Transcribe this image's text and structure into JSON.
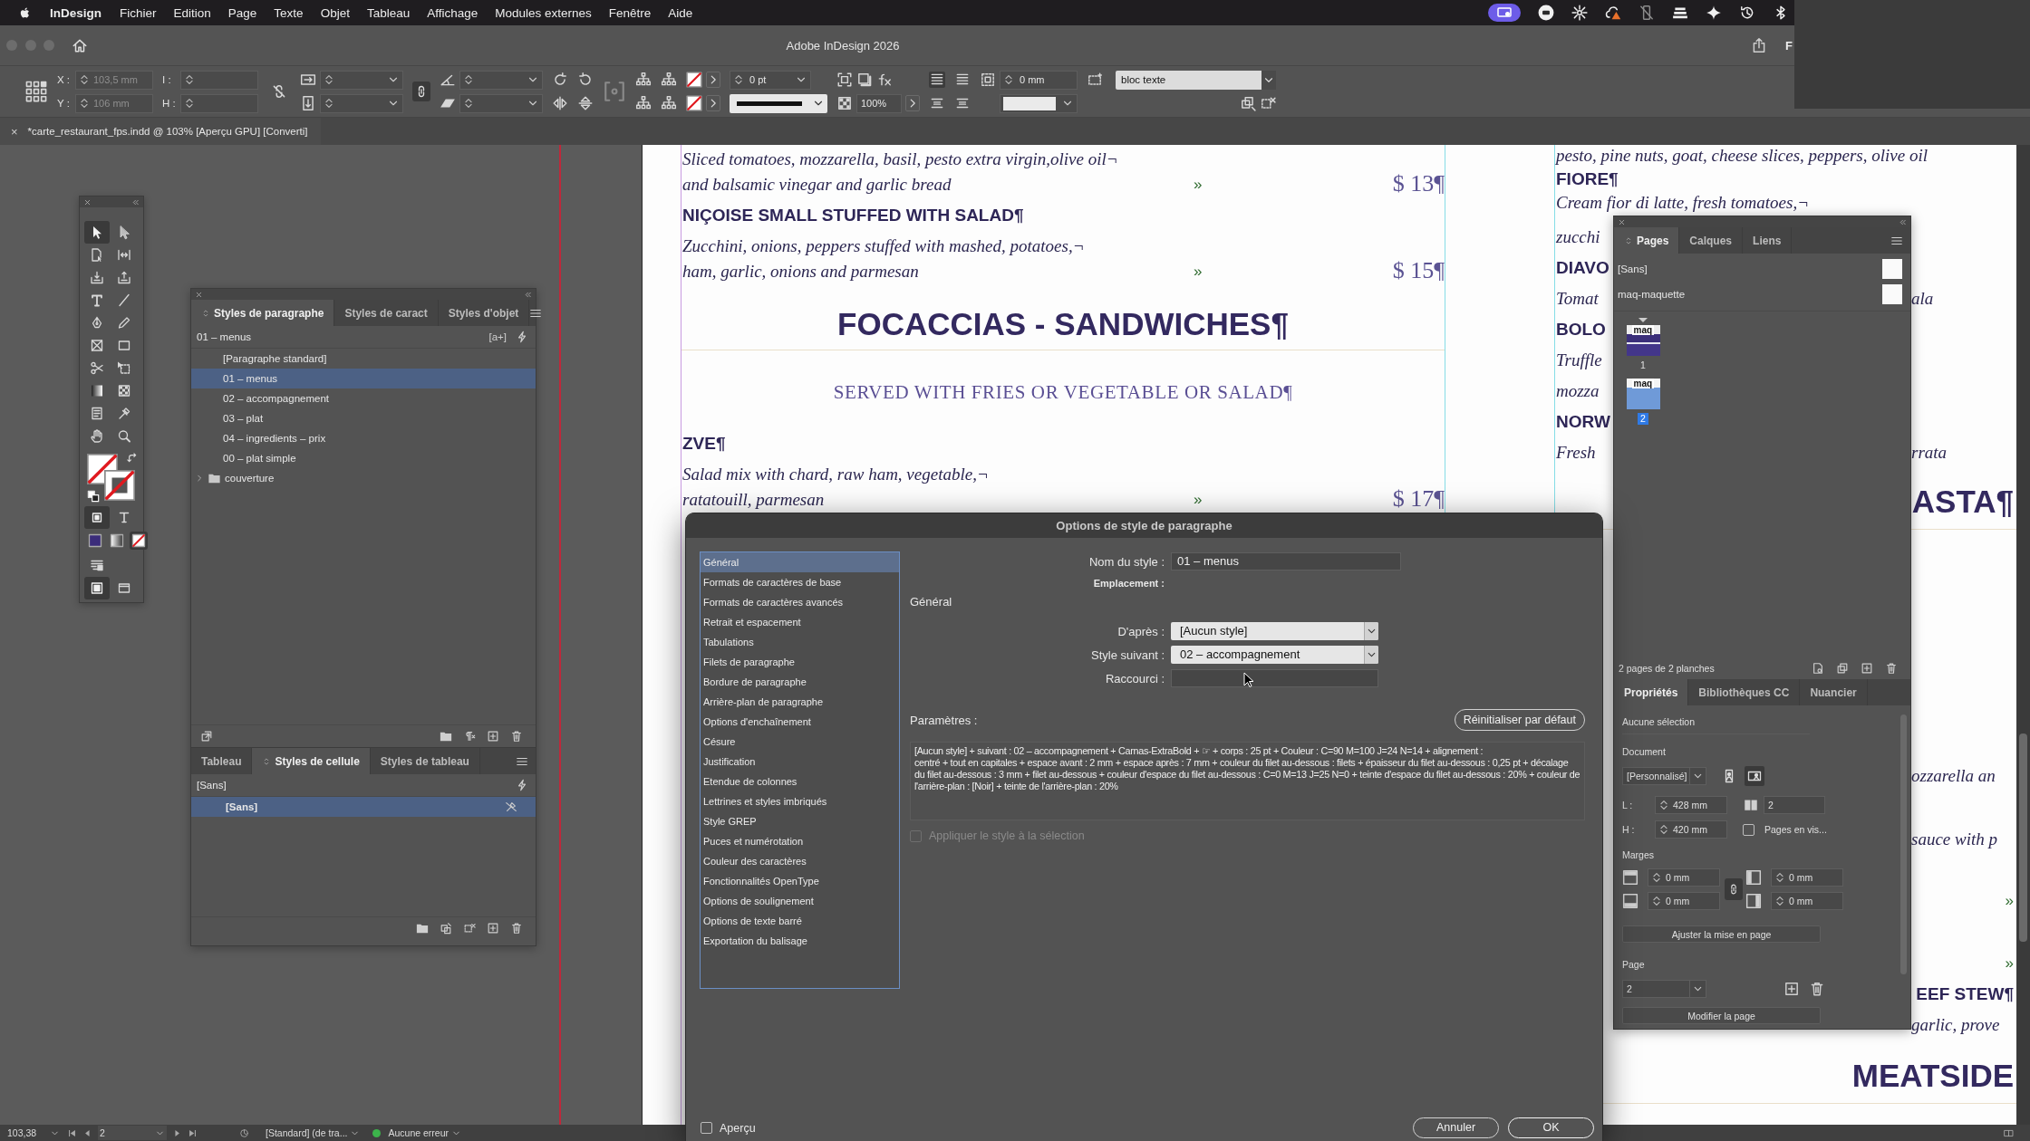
{
  "menu_bar": {
    "app": "InDesign",
    "items": [
      "Fichier",
      "Edition",
      "Page",
      "Texte",
      "Objet",
      "Tableau",
      "Affichage",
      "Modules externes",
      "Fenêtre",
      "Aide"
    ]
  },
  "title_bar": {
    "title": "Adobe InDesign 2026",
    "cut_label": "F"
  },
  "control_bar": {
    "x_label": "X :",
    "x_value": "103,5 mm",
    "y_label": "Y :",
    "y_value": "106 mm",
    "w_label": "I :",
    "h_label": "H :",
    "stroke_weight": "0 pt",
    "scale": "100%",
    "offset": "0 mm",
    "object_style": "bloc texte"
  },
  "document_tab": {
    "close": "×",
    "title": "*carte_restaurant_fps.indd @ 103% [Aperçu GPU] [Converti]"
  },
  "page": {
    "left_column": [
      {
        "kind": "dish",
        "lines": [
          "Sliced tomatoes, mozzarella, basil, pesto extra virgin,olive oil¬",
          "and balsamic vinegar and garlic bread"
        ],
        "tab": "»",
        "price": "$ 13¶"
      },
      {
        "kind": "title",
        "text": "NIÇOISE SMALL STUFFED WITH SALAD¶"
      },
      {
        "kind": "dish",
        "lines": [
          "Zucchini, onions, peppers stuffed with mashed, potatoes,¬",
          "ham, garlic, onions and parmesan"
        ],
        "tab": "»",
        "price": "$ 15¶"
      },
      {
        "kind": "section",
        "text": "FOCACCIAS - SANDWICHES¶"
      },
      {
        "kind": "subtitle",
        "text": "SERVED WITH FRIES OR VEGETABLE OR SALAD¶"
      },
      {
        "kind": "title",
        "text": "ZVE¶"
      },
      {
        "kind": "dish",
        "lines": [
          "Salad mix with chard, raw ham, vegetable,¬",
          "ratatouill, parmesan"
        ],
        "tab": "»",
        "price": "$ 17¶"
      }
    ],
    "right_column": [
      {
        "kind": "desc",
        "text": "pesto, pine nuts, goat, cheese slices, peppers, olive oil"
      },
      {
        "kind": "title",
        "text": "FIORE¶"
      },
      {
        "kind": "desc",
        "text": "Cream fior di latte, fresh tomatoes,¬"
      },
      {
        "kind": "desc",
        "text": "zucchi"
      },
      {
        "kind": "title",
        "text": "DIAVO"
      },
      {
        "kind": "desc",
        "text": "Tomat",
        "tail": "ala"
      },
      {
        "kind": "title",
        "text": "BOLO"
      },
      {
        "kind": "desc",
        "text": "Truffle"
      },
      {
        "kind": "desc",
        "text": "mozza"
      },
      {
        "kind": "title",
        "text": "NORW"
      },
      {
        "kind": "desc",
        "text": "Fresh",
        "tail": "rrata"
      },
      {
        "kind": "section",
        "tail": "ASTA¶"
      },
      {
        "kind": "desc",
        "tail": "ozzarella an"
      },
      {
        "kind": "desc",
        "tail": "sauce with p"
      },
      {
        "kind": "tab",
        "tail": "»"
      },
      {
        "kind": "tab",
        "tail": "»"
      },
      {
        "kind": "title",
        "tail": "EEF STEW¶"
      },
      {
        "kind": "desc",
        "tail": "garlic, prove"
      },
      {
        "kind": "section",
        "tail": "MEATSIDE"
      }
    ]
  },
  "tools_panel": {
    "tools": [
      {
        "selected": true
      },
      {
        "selected": false
      },
      {
        "selected": false
      },
      {
        "selected": false
      },
      {
        "selected": false
      },
      {
        "selected": false
      },
      {
        "selected": false
      },
      {
        "selected": false
      },
      {
        "selected": false
      },
      {
        "selected": false
      },
      {
        "selected": false
      },
      {
        "selected": false
      },
      {
        "selected": false
      },
      {
        "selected": false
      },
      {
        "selected": false
      },
      {
        "selected": false
      },
      {
        "selected": false
      },
      {
        "selected": false
      },
      {
        "selected": false
      },
      {
        "selected": false
      }
    ],
    "formatting_targets": [
      {
        "selected": true
      },
      {
        "selected": false
      }
    ],
    "fill_modes": [
      {
        "selected": false
      },
      {
        "selected": false
      },
      {
        "selected": true
      }
    ],
    "screen_modes": [
      {
        "selected": true
      },
      {
        "selected": false
      }
    ]
  },
  "paragraph_styles_panel": {
    "tabs": [
      {
        "label": "Styles de paragraphe",
        "selected": true
      },
      {
        "label": "Styles de caract",
        "selected": false
      },
      {
        "label": "Styles d'objet",
        "selected": false
      }
    ],
    "current_style": "01 – menus",
    "override_button": "[a+]",
    "styles": [
      {
        "label": "[Paragraphe standard]",
        "selected": false
      },
      {
        "label": "01 – menus",
        "selected": true
      },
      {
        "label": "02 – accompagnement",
        "selected": false
      },
      {
        "label": "03 – plat",
        "selected": false
      },
      {
        "label": "04 – ingredients – prix",
        "selected": false
      },
      {
        "label": "00 – plat simple",
        "selected": false
      }
    ],
    "groups": [
      {
        "label": "couverture",
        "expanded": false
      }
    ]
  },
  "cell_styles_panel": {
    "tabs": [
      {
        "label": "Tableau",
        "selected": false
      },
      {
        "label": "Styles de cellule",
        "selected": true
      },
      {
        "label": "Styles de tableau",
        "selected": false
      }
    ],
    "current_style": "[Sans]",
    "styles": [
      {
        "label": "[Sans]",
        "selected": true
      }
    ]
  },
  "dialog": {
    "title": "Options de style de paragraphe",
    "categories": [
      {
        "label": "Général",
        "selected": true
      },
      {
        "label": "Formats de caractères de base",
        "selected": false
      },
      {
        "label": "Formats de caractères avancés",
        "selected": false
      },
      {
        "label": "Retrait et espacement",
        "selected": false
      },
      {
        "label": "Tabulations",
        "selected": false
      },
      {
        "label": "Filets de paragraphe",
        "selected": false
      },
      {
        "label": "Bordure de paragraphe",
        "selected": false
      },
      {
        "label": "Arrière-plan de paragraphe",
        "selected": false
      },
      {
        "label": "Options d'enchaînement",
        "selected": false
      },
      {
        "label": "Césure",
        "selected": false
      },
      {
        "label": "Justification",
        "selected": false
      },
      {
        "label": "Etendue de colonnes",
        "selected": false
      },
      {
        "label": "Lettrines et styles imbriqués",
        "selected": false
      },
      {
        "label": "Style GREP",
        "selected": false
      },
      {
        "label": "Puces et numérotation",
        "selected": false
      },
      {
        "label": "Couleur des caractères",
        "selected": false
      },
      {
        "label": "Fonctionnalités OpenType",
        "selected": false
      },
      {
        "label": "Options de soulignement",
        "selected": false
      },
      {
        "label": "Options de texte barré",
        "selected": false
      },
      {
        "label": "Exportation du balisage",
        "selected": false
      }
    ],
    "style_name_label": "Nom du style :",
    "style_name": "01 – menus",
    "location_label": "Emplacement :",
    "section_title": "Général",
    "based_on_label": "D'après :",
    "based_on": "[Aucun style]",
    "next_style_label": "Style suivant :",
    "next_style": "02 – accompagnement",
    "shortcut_label": "Raccourci :",
    "settings_label": "Paramètres :",
    "reset_button": "Réinitialiser par défaut",
    "settings": "[Aucun style] + suivant : 02 – accompagnement + Carnas-ExtraBold + ☞ + corps : 25 pt + Couleur : C=90 M=100 J=24 N=14 + alignement :\ncentré + tout en capitales + espace avant : 2 mm + espace après : 7 mm + couleur du filet au-dessous : filets + épaisseur du filet au-dessous : 0,25 pt + décalage du filet au-dessous : 3 mm + filet au-dessous + couleur d'espace du filet au-dessous : C=0 M=13 J=25 N=0 + teinte d'espace du filet au-dessous : 20% + couleur de l'arrière-plan : [Noir] + teinte de l'arrière-plan : 20%",
    "apply_to_selection": {
      "label": "Appliquer le style à la sélection",
      "checked": false,
      "disabled": true
    },
    "preview": {
      "label": "Aperçu",
      "checked": false
    },
    "buttons": [
      "Annuler",
      "OK"
    ]
  },
  "pages_panel": {
    "tabs": [
      {
        "label": "Pages",
        "selected": true
      },
      {
        "label": "Calques",
        "selected": false
      },
      {
        "label": "Liens",
        "selected": false
      }
    ],
    "masters": [
      "[Sans]",
      "maq-maquette"
    ],
    "pages": [
      {
        "number": "1",
        "master": "maq",
        "selected": false
      },
      {
        "number": "2",
        "master": "maq",
        "selected": true
      }
    ],
    "summary": "2 pages de 2 planches"
  },
  "properties_panel": {
    "tabs": [
      {
        "label": "Propriétés",
        "selected": true
      },
      {
        "label": "Bibliothèques CC",
        "selected": false
      },
      {
        "label": "Nuancier",
        "selected": false
      }
    ],
    "selection": "Aucune sélection",
    "document_label": "Document",
    "preset": "[Personnalisé]",
    "width_label": "L :",
    "width": "428 mm",
    "height_label": "H :",
    "height": "420 mm",
    "page_count": "2",
    "facing_pages": {
      "label": "Pages en vis...",
      "checked": false
    },
    "margins_label": "Marges",
    "margins": [
      "0 mm",
      "0 mm",
      "0 mm",
      "0 mm"
    ],
    "adjust_button": "Ajuster la mise en page",
    "page_label": "Page",
    "page": "2",
    "edit_page_button": "Modifier la page"
  },
  "status_bar": {
    "zoom": "103,38",
    "page": "2",
    "profile": "[Standard] (de tra...",
    "errors": "Aucune erreur"
  }
}
